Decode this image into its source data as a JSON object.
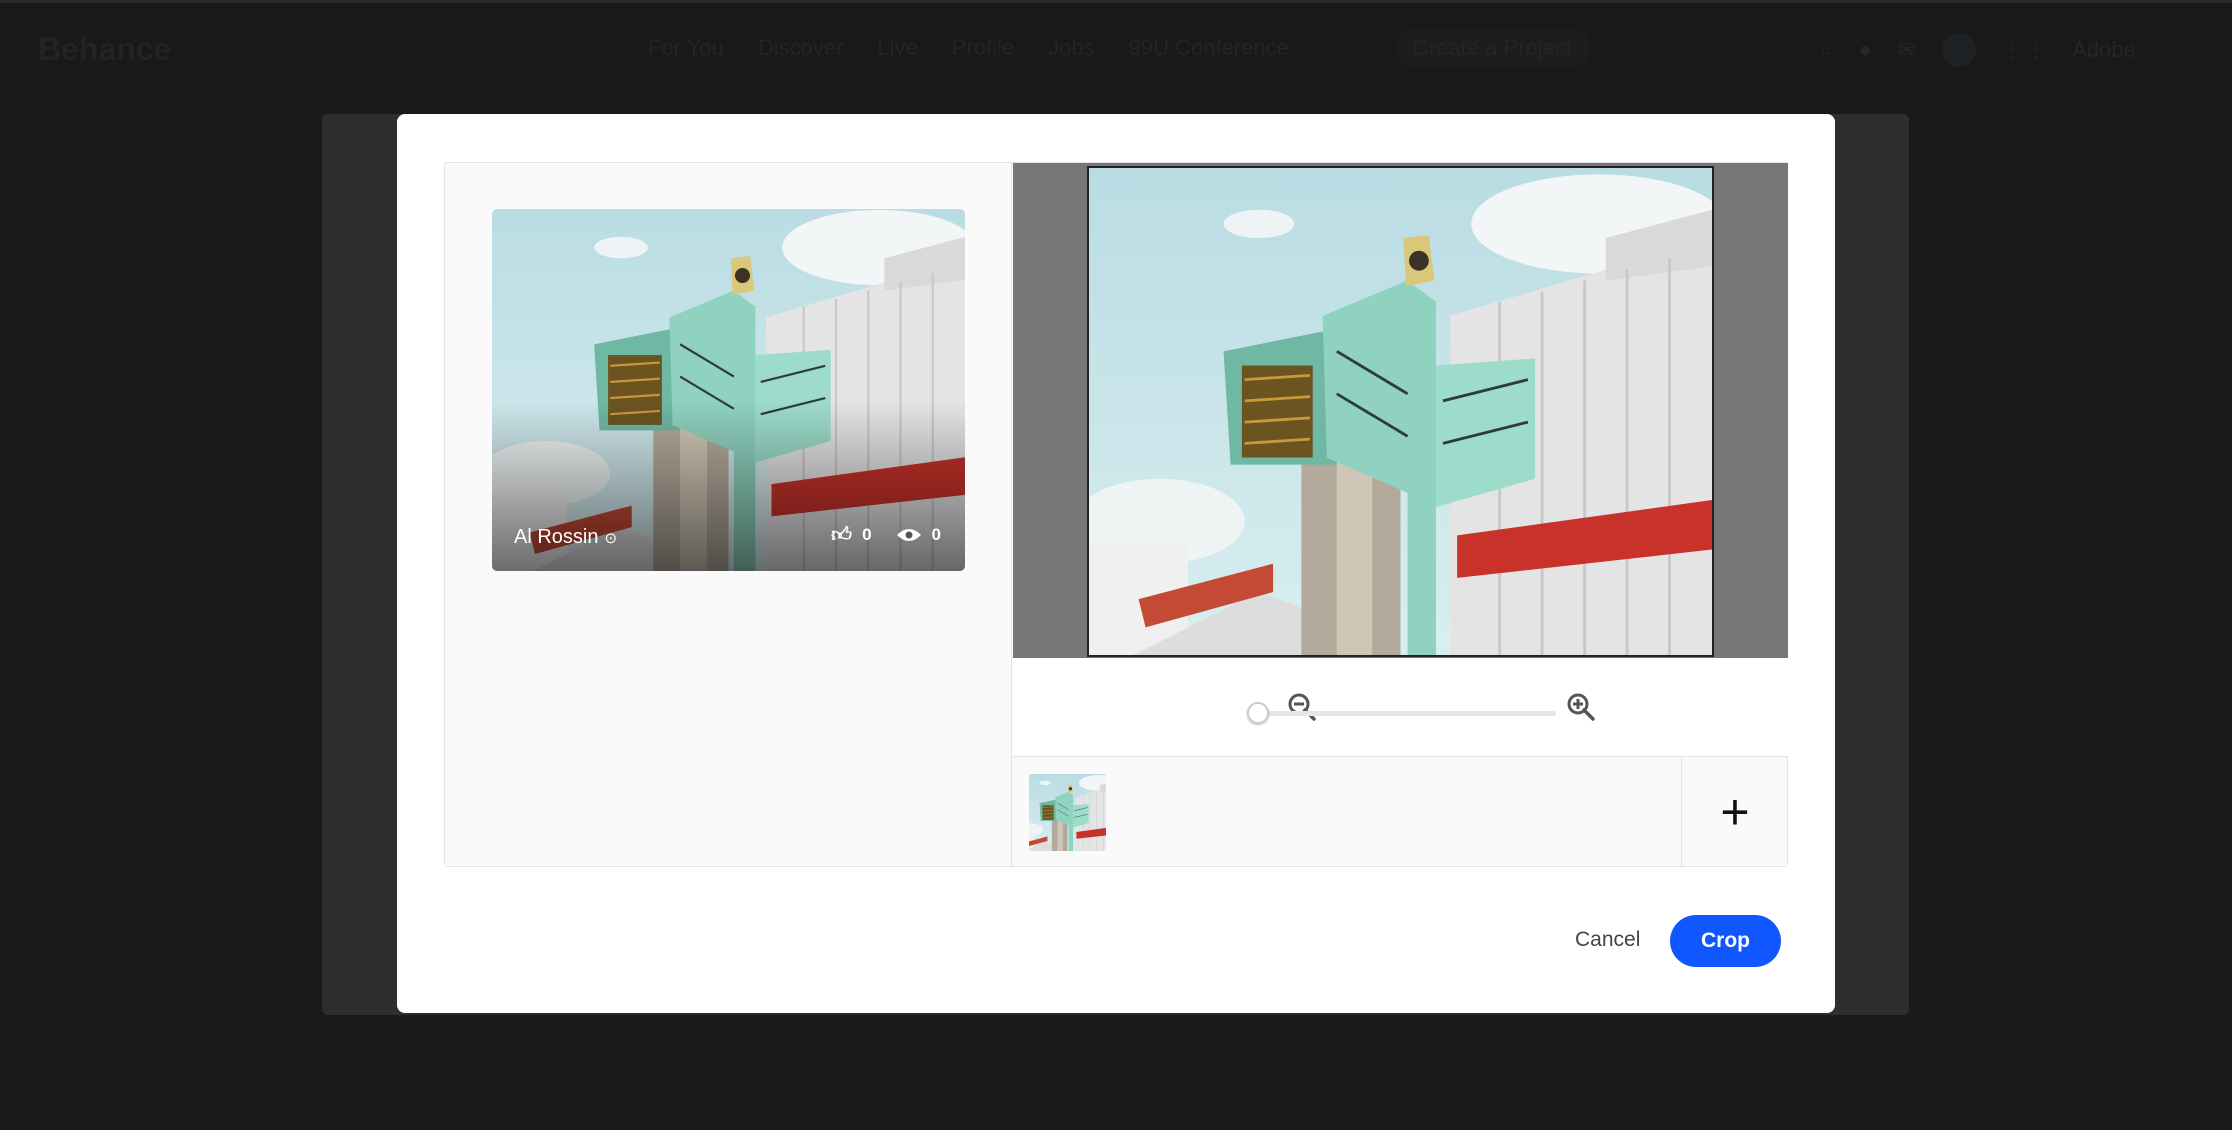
{
  "nav": {
    "logo": "Behance",
    "links": [
      "For You",
      "Discover",
      "Live",
      "Profile",
      "Jobs",
      "99U Conference"
    ],
    "create_project": "Create a Project",
    "adobe": "Adobe"
  },
  "card": {
    "owner": "Al Rossin",
    "appreciations": "0",
    "views": "0"
  },
  "cropper": {
    "zoom_level_percent": 0
  },
  "actions": {
    "cancel": "Cancel",
    "crop": "Crop"
  },
  "colors": {
    "primary": "#1057ff",
    "crop_backdrop": "#777777"
  }
}
